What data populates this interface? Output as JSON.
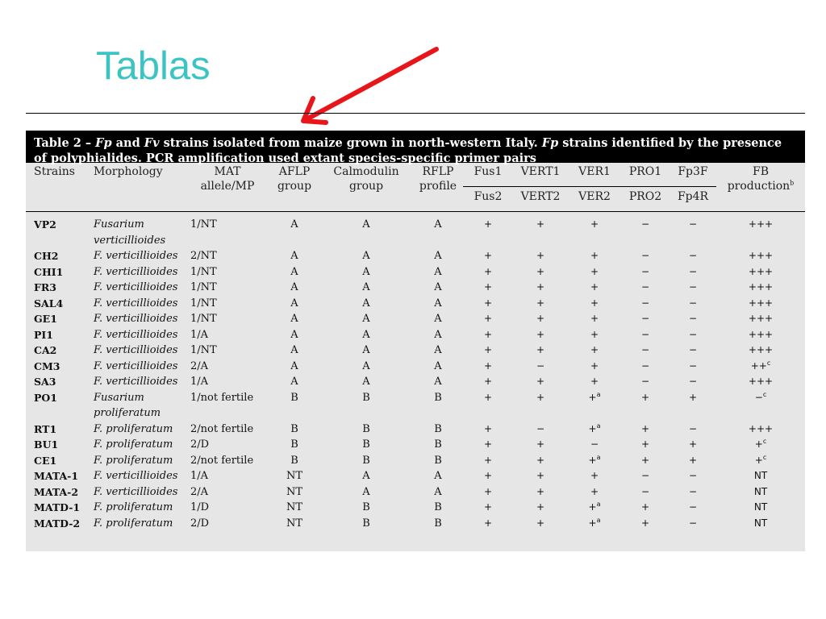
{
  "slide": {
    "title": "Tablas"
  },
  "table": {
    "caption_prefix": "Table 2 – ",
    "caption_fp": "Fp",
    "caption_and": " and ",
    "caption_fv": "Fv",
    "caption_mid": " strains isolated from maize grown in north-western Italy. ",
    "caption_fp2": "Fp",
    "caption_rest": " strains identified by the presence of polyphialides. PCR amplification used extant species-specific primer pairs",
    "headers": {
      "strains": "Strains",
      "morphology": "Morphology",
      "mat_1": "MAT",
      "mat_2": "allele/MP",
      "aflp_1": "AFLP",
      "aflp_2": "group",
      "calm_1": "Calmodulin",
      "calm_2": "group",
      "rflp_1": "RFLP",
      "rflp_2": "profile",
      "fus1": "Fus1",
      "fus2": "Fus2",
      "vert1": "VERT1",
      "vert2": "VERT2",
      "ver1": "VER1",
      "ver2": "VER2",
      "pro1": "PRO1",
      "pro2": "PRO2",
      "fp3f": "Fp3F",
      "fp4r": "Fp4R",
      "fb_1": "FB",
      "fb_2": "production",
      "fb_sup": "b"
    },
    "rows": [
      {
        "strain": "VP2",
        "morph": "Fusarium verticillioides",
        "mat": "1/NT",
        "aflp": "A",
        "calm": "A",
        "rflp": "A",
        "fus": "+",
        "vert": "+",
        "ver": "+",
        "ver_sup": "",
        "pro": "−",
        "fp": "−",
        "fb": "+++",
        "fb_sup": ""
      },
      {
        "strain": "CH2",
        "morph": "F. verticillioides",
        "mat": "2/NT",
        "aflp": "A",
        "calm": "A",
        "rflp": "A",
        "fus": "+",
        "vert": "+",
        "ver": "+",
        "ver_sup": "",
        "pro": "−",
        "fp": "−",
        "fb": "+++",
        "fb_sup": ""
      },
      {
        "strain": "CHI1",
        "morph": "F. verticillioides",
        "mat": "1/NT",
        "aflp": "A",
        "calm": "A",
        "rflp": "A",
        "fus": "+",
        "vert": "+",
        "ver": "+",
        "ver_sup": "",
        "pro": "−",
        "fp": "−",
        "fb": "+++",
        "fb_sup": ""
      },
      {
        "strain": "FR3",
        "morph": "F. verticillioides",
        "mat": "1/NT",
        "aflp": "A",
        "calm": "A",
        "rflp": "A",
        "fus": "+",
        "vert": "+",
        "ver": "+",
        "ver_sup": "",
        "pro": "−",
        "fp": "−",
        "fb": "+++",
        "fb_sup": ""
      },
      {
        "strain": "SAL4",
        "morph": "F. verticillioides",
        "mat": "1/NT",
        "aflp": "A",
        "calm": "A",
        "rflp": "A",
        "fus": "+",
        "vert": "+",
        "ver": "+",
        "ver_sup": "",
        "pro": "−",
        "fp": "−",
        "fb": "+++",
        "fb_sup": ""
      },
      {
        "strain": "GE1",
        "morph": "F. verticillioides",
        "mat": "1/NT",
        "aflp": "A",
        "calm": "A",
        "rflp": "A",
        "fus": "+",
        "vert": "+",
        "ver": "+",
        "ver_sup": "",
        "pro": "−",
        "fp": "−",
        "fb": "+++",
        "fb_sup": ""
      },
      {
        "strain": "PI1",
        "morph": "F. verticillioides",
        "mat": "1/A",
        "aflp": "A",
        "calm": "A",
        "rflp": "A",
        "fus": "+",
        "vert": "+",
        "ver": "+",
        "ver_sup": "",
        "pro": "−",
        "fp": "−",
        "fb": "+++",
        "fb_sup": ""
      },
      {
        "strain": "CA2",
        "morph": "F. verticillioides",
        "mat": "1/NT",
        "aflp": "A",
        "calm": "A",
        "rflp": "A",
        "fus": "+",
        "vert": "+",
        "ver": "+",
        "ver_sup": "",
        "pro": "−",
        "fp": "−",
        "fb": "+++",
        "fb_sup": ""
      },
      {
        "strain": "CM3",
        "morph": "F. verticillioides",
        "mat": "2/A",
        "aflp": "A",
        "calm": "A",
        "rflp": "A",
        "fus": "+",
        "vert": "−",
        "ver": "+",
        "ver_sup": "",
        "pro": "−",
        "fp": "−",
        "fb": "++",
        "fb_sup": "c"
      },
      {
        "strain": "SA3",
        "morph": "F. verticillioides",
        "mat": "1/A",
        "aflp": "A",
        "calm": "A",
        "rflp": "A",
        "fus": "+",
        "vert": "+",
        "ver": "+",
        "ver_sup": "",
        "pro": "−",
        "fp": "−",
        "fb": "+++",
        "fb_sup": ""
      },
      {
        "strain": "PO1",
        "morph": "Fusarium proliferatum",
        "mat": "1/not fertile",
        "aflp": "B",
        "calm": "B",
        "rflp": "B",
        "fus": "+",
        "vert": "+",
        "ver": "+",
        "ver_sup": "a",
        "pro": "+",
        "fp": "+",
        "fb": "−",
        "fb_sup": "c"
      },
      {
        "strain": "RT1",
        "morph": "F. proliferatum",
        "mat": "2/not fertile",
        "aflp": "B",
        "calm": "B",
        "rflp": "B",
        "fus": "+",
        "vert": "−",
        "ver": "+",
        "ver_sup": "a",
        "pro": "+",
        "fp": "−",
        "fb": "+++",
        "fb_sup": ""
      },
      {
        "strain": "BU1",
        "morph": "F. proliferatum",
        "mat": "2/D",
        "aflp": "B",
        "calm": "B",
        "rflp": "B",
        "fus": "+",
        "vert": "+",
        "ver": "−",
        "ver_sup": "",
        "pro": "+",
        "fp": "+",
        "fb": "+",
        "fb_sup": "c"
      },
      {
        "strain": "CE1",
        "morph": "F. proliferatum",
        "mat": "2/not fertile",
        "aflp": "B",
        "calm": "B",
        "rflp": "B",
        "fus": "+",
        "vert": "+",
        "ver": "+",
        "ver_sup": "a",
        "pro": "+",
        "fp": "+",
        "fb": "+",
        "fb_sup": "c"
      },
      {
        "strain": "MATA-1",
        "morph": "F. verticillioides",
        "mat": "1/A",
        "aflp": "NT",
        "calm": "A",
        "rflp": "A",
        "fus": "+",
        "vert": "+",
        "ver": "+",
        "ver_sup": "",
        "pro": "−",
        "fp": "−",
        "fb": "NT",
        "fb_sup": ""
      },
      {
        "strain": "MATA-2",
        "morph": "F. verticillioides",
        "mat": "2/A",
        "aflp": "NT",
        "calm": "A",
        "rflp": "A",
        "fus": "+",
        "vert": "+",
        "ver": "+",
        "ver_sup": "",
        "pro": "−",
        "fp": "−",
        "fb": "NT",
        "fb_sup": ""
      },
      {
        "strain": "MATD-1",
        "morph": "F. proliferatum",
        "mat": "1/D",
        "aflp": "NT",
        "calm": "B",
        "rflp": "B",
        "fus": "+",
        "vert": "+",
        "ver": "+",
        "ver_sup": "a",
        "pro": "+",
        "fp": "−",
        "fb": "NT",
        "fb_sup": ""
      },
      {
        "strain": "MATD-2",
        "morph": "F. proliferatum",
        "mat": "2/D",
        "aflp": "NT",
        "calm": "B",
        "rflp": "B",
        "fus": "+",
        "vert": "+",
        "ver": "+",
        "ver_sup": "a",
        "pro": "+",
        "fp": "−",
        "fb": "NT",
        "fb_sup": ""
      }
    ]
  },
  "colors": {
    "title": "#3cc4c4",
    "arrow": "#e8161b",
    "caption_bg": "#000000",
    "table_bg": "#e6e6e6"
  }
}
